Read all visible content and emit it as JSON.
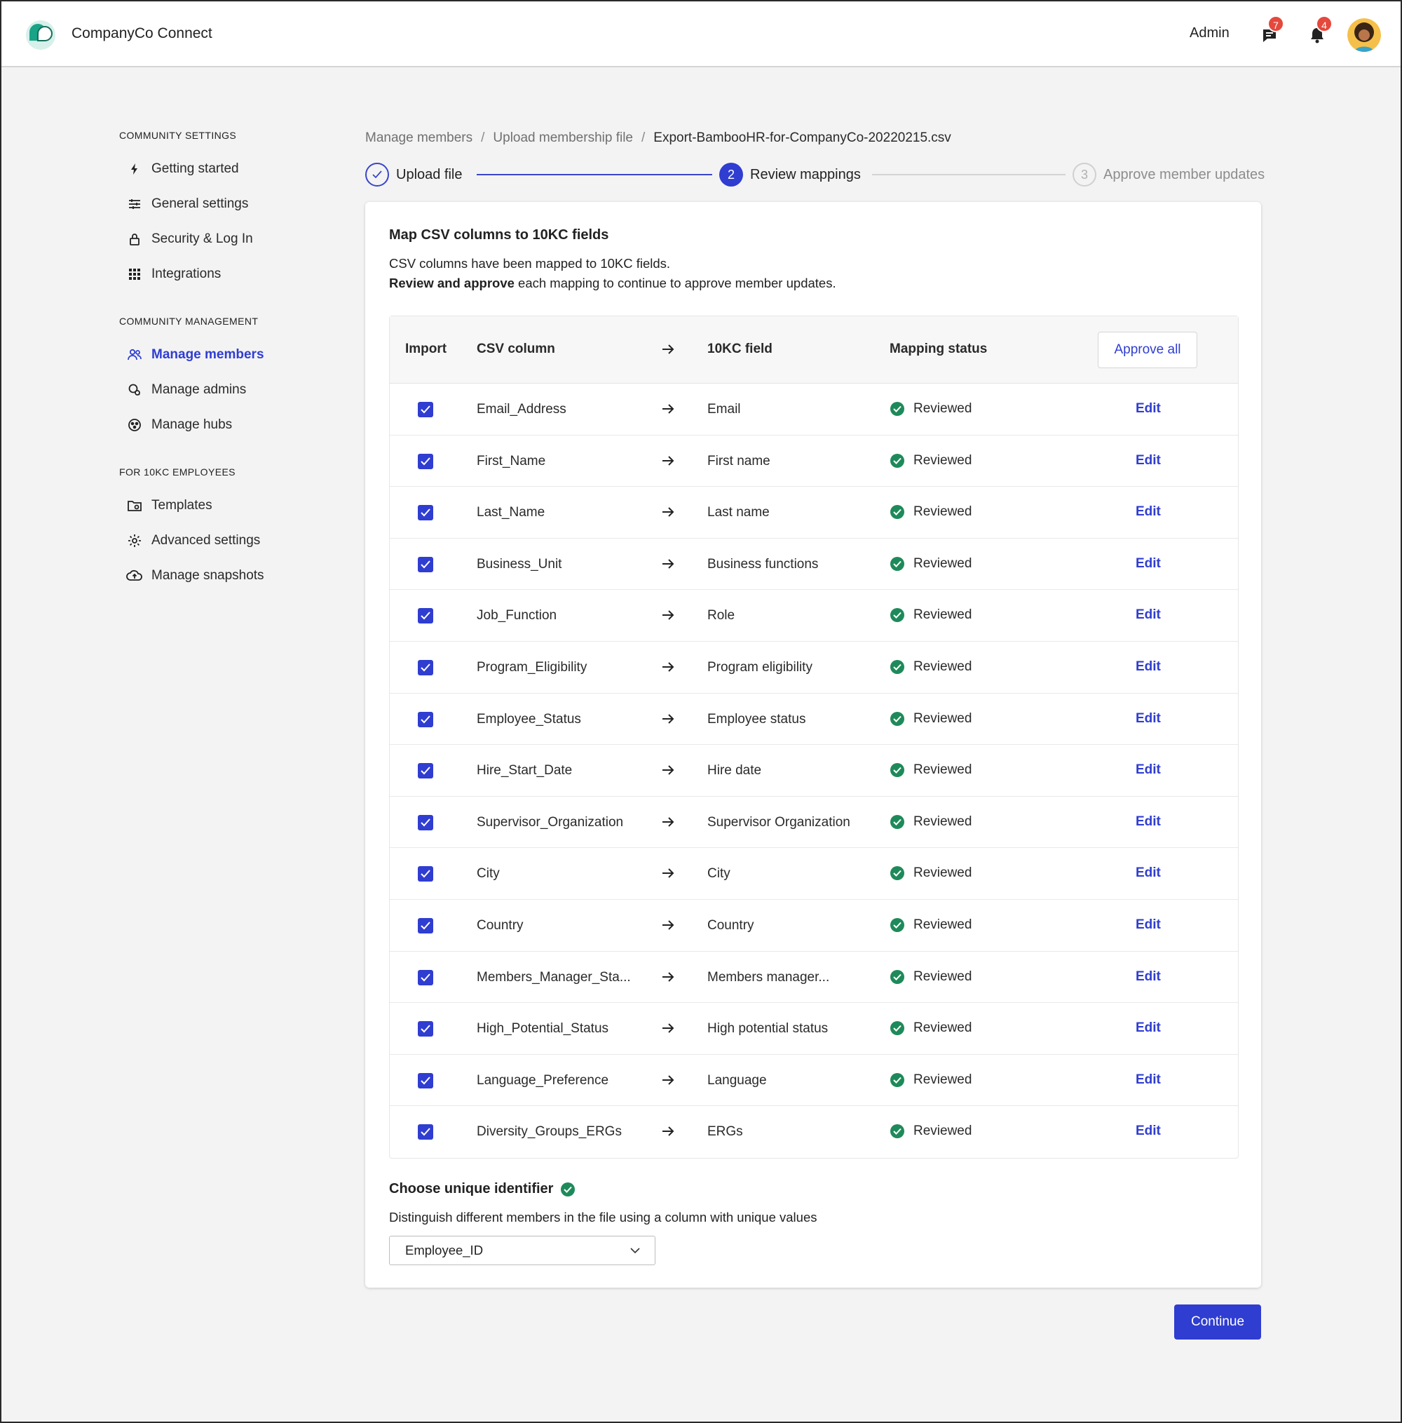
{
  "header": {
    "app_title": "CompanyCo Connect",
    "admin_label": "Admin",
    "chat_badge": "7",
    "notification_badge": "4"
  },
  "sidebar": {
    "sections": [
      {
        "title": "COMMUNITY SETTINGS",
        "items": [
          {
            "label": "Getting started",
            "icon": "lightning-icon"
          },
          {
            "label": "General settings",
            "icon": "sliders-icon"
          },
          {
            "label": "Security & Log In",
            "icon": "lock-icon"
          },
          {
            "label": "Integrations",
            "icon": "grid-icon"
          }
        ]
      },
      {
        "title": "COMMUNITY MANAGEMENT",
        "items": [
          {
            "label": "Manage members",
            "icon": "users-icon",
            "active": true
          },
          {
            "label": "Manage admins",
            "icon": "admin-shield-icon"
          },
          {
            "label": "Manage hubs",
            "icon": "hub-icon"
          }
        ]
      },
      {
        "title": "FOR 10KC EMPLOYEES",
        "items": [
          {
            "label": "Templates",
            "icon": "folder-icon"
          },
          {
            "label": "Advanced settings",
            "icon": "gear-icon"
          },
          {
            "label": "Manage snapshots",
            "icon": "cloud-upload-icon"
          }
        ]
      }
    ]
  },
  "breadcrumb": {
    "items": [
      "Manage members",
      "Upload membership file"
    ],
    "current": "Export-BambooHR-for-CompanyCo-20220215.csv"
  },
  "stepper": {
    "step1": "Upload file",
    "step2_num": "2",
    "step2": "Review mappings",
    "step3_num": "3",
    "step3": "Approve member updates"
  },
  "card": {
    "title": "Map CSV columns to 10KC fields",
    "desc1": "CSV columns have been mapped to 10KC fields.",
    "desc2_bold": "Review and approve",
    "desc2_rest": " each mapping to continue to approve member updates."
  },
  "table": {
    "headers": {
      "import": "Import",
      "csv_column": "CSV column",
      "field": "10KC field",
      "status": "Mapping status"
    },
    "approve_all_label": "Approve all",
    "edit_label": "Edit",
    "rows": [
      {
        "csv": "Email_Address",
        "field": "Email",
        "status": "Reviewed"
      },
      {
        "csv": "First_Name",
        "field": "First name",
        "status": "Reviewed"
      },
      {
        "csv": "Last_Name",
        "field": "Last name",
        "status": "Reviewed"
      },
      {
        "csv": "Business_Unit",
        "field": "Business functions",
        "status": "Reviewed"
      },
      {
        "csv": "Job_Function",
        "field": "Role",
        "status": "Reviewed"
      },
      {
        "csv": "Program_Eligibility",
        "field": "Program eligibility",
        "status": "Reviewed"
      },
      {
        "csv": "Employee_Status",
        "field": "Employee status",
        "status": "Reviewed"
      },
      {
        "csv": "Hire_Start_Date",
        "field": "Hire date",
        "status": "Reviewed"
      },
      {
        "csv": "Supervisor_Organization",
        "field": "Supervisor Organization",
        "status": "Reviewed"
      },
      {
        "csv": "City",
        "field": "City",
        "status": "Reviewed"
      },
      {
        "csv": "Country",
        "field": "Country",
        "status": "Reviewed"
      },
      {
        "csv": "Members_Manager_Sta...",
        "field": "Members manager...",
        "status": "Reviewed"
      },
      {
        "csv": "High_Potential_Status",
        "field": "High potential status",
        "status": "Reviewed"
      },
      {
        "csv": "Language_Preference",
        "field": "Language",
        "status": "Reviewed"
      },
      {
        "csv": "Diversity_Groups_ERGs",
        "field": "ERGs",
        "status": "Reviewed"
      }
    ]
  },
  "unique_identifier": {
    "title": "Choose unique identifier",
    "desc": "Distinguish different members in the file using a column with unique values",
    "selected": "Employee_ID"
  },
  "continue_label": "Continue",
  "colors": {
    "accent": "#2f3dd1",
    "success": "#1e8a5a",
    "badge": "#e5483c",
    "brand": "#1aa386"
  }
}
